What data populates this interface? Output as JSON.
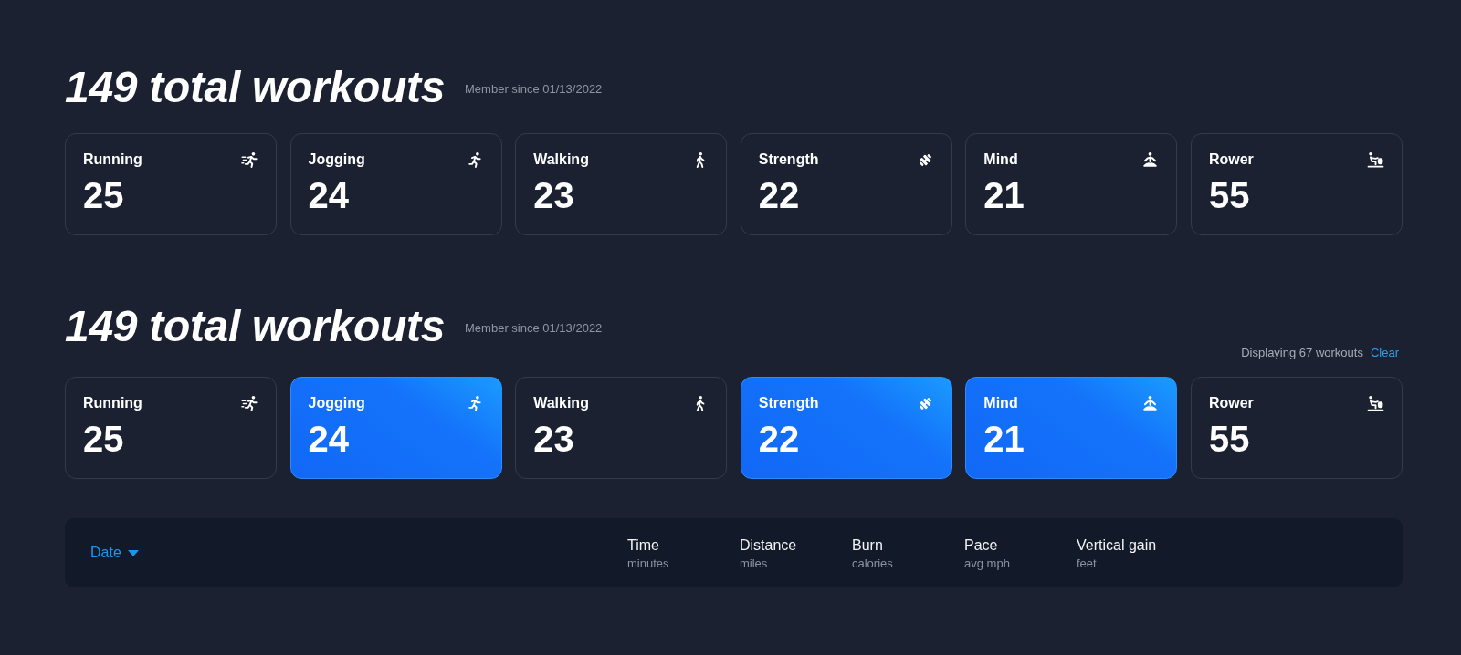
{
  "sections": [
    {
      "title": "149 total workouts",
      "member_since": "Member since 01/13/2022",
      "cards": [
        {
          "label": "Running",
          "count": "25",
          "kind": "running",
          "selected": false
        },
        {
          "label": "Jogging",
          "count": "24",
          "kind": "jogging",
          "selected": false
        },
        {
          "label": "Walking",
          "count": "23",
          "kind": "walking",
          "selected": false
        },
        {
          "label": "Strength",
          "count": "22",
          "kind": "strength",
          "selected": false
        },
        {
          "label": "Mind",
          "count": "21",
          "kind": "mind",
          "selected": false
        },
        {
          "label": "Rower",
          "count": "55",
          "kind": "rower",
          "selected": false
        }
      ]
    },
    {
      "title": "149 total workouts",
      "member_since": "Member since 01/13/2022",
      "filter_status": {
        "text": "Displaying 67 workouts",
        "clear_label": "Clear"
      },
      "cards": [
        {
          "label": "Running",
          "count": "25",
          "kind": "running",
          "selected": false
        },
        {
          "label": "Jogging",
          "count": "24",
          "kind": "jogging",
          "selected": true
        },
        {
          "label": "Walking",
          "count": "23",
          "kind": "walking",
          "selected": false
        },
        {
          "label": "Strength",
          "count": "22",
          "kind": "strength",
          "selected": true
        },
        {
          "label": "Mind",
          "count": "21",
          "kind": "mind",
          "selected": true
        },
        {
          "label": "Rower",
          "count": "55",
          "kind": "rower",
          "selected": false
        }
      ]
    }
  ],
  "table_header": {
    "sort": {
      "label": "Date",
      "descending": true
    },
    "columns": [
      {
        "label": "Time",
        "unit": "minutes"
      },
      {
        "label": "Distance",
        "unit": "miles"
      },
      {
        "label": "Burn",
        "unit": "calories"
      },
      {
        "label": "Pace",
        "unit": "avg mph"
      },
      {
        "label": "Vertical gain",
        "unit": "feet"
      }
    ]
  }
}
